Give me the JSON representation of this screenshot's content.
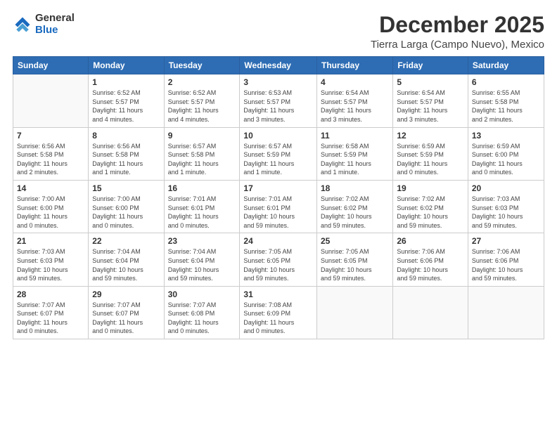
{
  "logo": {
    "general": "General",
    "blue": "Blue"
  },
  "title": "December 2025",
  "subtitle": "Tierra Larga (Campo Nuevo), Mexico",
  "days_of_week": [
    "Sunday",
    "Monday",
    "Tuesday",
    "Wednesday",
    "Thursday",
    "Friday",
    "Saturday"
  ],
  "weeks": [
    [
      {
        "day": "",
        "info": ""
      },
      {
        "day": "1",
        "info": "Sunrise: 6:52 AM\nSunset: 5:57 PM\nDaylight: 11 hours\nand 4 minutes."
      },
      {
        "day": "2",
        "info": "Sunrise: 6:52 AM\nSunset: 5:57 PM\nDaylight: 11 hours\nand 4 minutes."
      },
      {
        "day": "3",
        "info": "Sunrise: 6:53 AM\nSunset: 5:57 PM\nDaylight: 11 hours\nand 3 minutes."
      },
      {
        "day": "4",
        "info": "Sunrise: 6:54 AM\nSunset: 5:57 PM\nDaylight: 11 hours\nand 3 minutes."
      },
      {
        "day": "5",
        "info": "Sunrise: 6:54 AM\nSunset: 5:57 PM\nDaylight: 11 hours\nand 3 minutes."
      },
      {
        "day": "6",
        "info": "Sunrise: 6:55 AM\nSunset: 5:58 PM\nDaylight: 11 hours\nand 2 minutes."
      }
    ],
    [
      {
        "day": "7",
        "info": "Sunrise: 6:56 AM\nSunset: 5:58 PM\nDaylight: 11 hours\nand 2 minutes."
      },
      {
        "day": "8",
        "info": "Sunrise: 6:56 AM\nSunset: 5:58 PM\nDaylight: 11 hours\nand 1 minute."
      },
      {
        "day": "9",
        "info": "Sunrise: 6:57 AM\nSunset: 5:58 PM\nDaylight: 11 hours\nand 1 minute."
      },
      {
        "day": "10",
        "info": "Sunrise: 6:57 AM\nSunset: 5:59 PM\nDaylight: 11 hours\nand 1 minute."
      },
      {
        "day": "11",
        "info": "Sunrise: 6:58 AM\nSunset: 5:59 PM\nDaylight: 11 hours\nand 1 minute."
      },
      {
        "day": "12",
        "info": "Sunrise: 6:59 AM\nSunset: 5:59 PM\nDaylight: 11 hours\nand 0 minutes."
      },
      {
        "day": "13",
        "info": "Sunrise: 6:59 AM\nSunset: 6:00 PM\nDaylight: 11 hours\nand 0 minutes."
      }
    ],
    [
      {
        "day": "14",
        "info": "Sunrise: 7:00 AM\nSunset: 6:00 PM\nDaylight: 11 hours\nand 0 minutes."
      },
      {
        "day": "15",
        "info": "Sunrise: 7:00 AM\nSunset: 6:00 PM\nDaylight: 11 hours\nand 0 minutes."
      },
      {
        "day": "16",
        "info": "Sunrise: 7:01 AM\nSunset: 6:01 PM\nDaylight: 11 hours\nand 0 minutes."
      },
      {
        "day": "17",
        "info": "Sunrise: 7:01 AM\nSunset: 6:01 PM\nDaylight: 10 hours\nand 59 minutes."
      },
      {
        "day": "18",
        "info": "Sunrise: 7:02 AM\nSunset: 6:02 PM\nDaylight: 10 hours\nand 59 minutes."
      },
      {
        "day": "19",
        "info": "Sunrise: 7:02 AM\nSunset: 6:02 PM\nDaylight: 10 hours\nand 59 minutes."
      },
      {
        "day": "20",
        "info": "Sunrise: 7:03 AM\nSunset: 6:03 PM\nDaylight: 10 hours\nand 59 minutes."
      }
    ],
    [
      {
        "day": "21",
        "info": "Sunrise: 7:03 AM\nSunset: 6:03 PM\nDaylight: 10 hours\nand 59 minutes."
      },
      {
        "day": "22",
        "info": "Sunrise: 7:04 AM\nSunset: 6:04 PM\nDaylight: 10 hours\nand 59 minutes."
      },
      {
        "day": "23",
        "info": "Sunrise: 7:04 AM\nSunset: 6:04 PM\nDaylight: 10 hours\nand 59 minutes."
      },
      {
        "day": "24",
        "info": "Sunrise: 7:05 AM\nSunset: 6:05 PM\nDaylight: 10 hours\nand 59 minutes."
      },
      {
        "day": "25",
        "info": "Sunrise: 7:05 AM\nSunset: 6:05 PM\nDaylight: 10 hours\nand 59 minutes."
      },
      {
        "day": "26",
        "info": "Sunrise: 7:06 AM\nSunset: 6:06 PM\nDaylight: 10 hours\nand 59 minutes."
      },
      {
        "day": "27",
        "info": "Sunrise: 7:06 AM\nSunset: 6:06 PM\nDaylight: 10 hours\nand 59 minutes."
      }
    ],
    [
      {
        "day": "28",
        "info": "Sunrise: 7:07 AM\nSunset: 6:07 PM\nDaylight: 11 hours\nand 0 minutes."
      },
      {
        "day": "29",
        "info": "Sunrise: 7:07 AM\nSunset: 6:07 PM\nDaylight: 11 hours\nand 0 minutes."
      },
      {
        "day": "30",
        "info": "Sunrise: 7:07 AM\nSunset: 6:08 PM\nDaylight: 11 hours\nand 0 minutes."
      },
      {
        "day": "31",
        "info": "Sunrise: 7:08 AM\nSunset: 6:09 PM\nDaylight: 11 hours\nand 0 minutes."
      },
      {
        "day": "",
        "info": ""
      },
      {
        "day": "",
        "info": ""
      },
      {
        "day": "",
        "info": ""
      }
    ]
  ]
}
